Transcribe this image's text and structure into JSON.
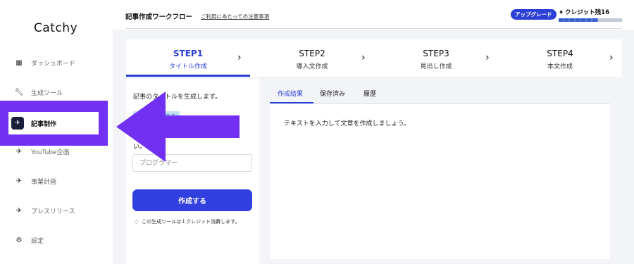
{
  "sidebar": {
    "logo": "Catchy",
    "items": [
      {
        "label": "ダッシュボード",
        "icon": "dashboard-icon"
      },
      {
        "label": "生成ツール",
        "icon": "wrench-icon"
      },
      {
        "label": "記事制作",
        "icon": "bird-icon",
        "active": true
      },
      {
        "label": "YouTube企画",
        "icon": "bird-icon"
      },
      {
        "label": "事業計画",
        "icon": "bird-icon"
      },
      {
        "label": "プレスリリース",
        "icon": "bird-icon"
      },
      {
        "label": "設定",
        "icon": "gear-icon"
      }
    ]
  },
  "header": {
    "title": "記事作成ワークフロー",
    "notice_link": "ご利用にあたっての注意事項",
    "upgrade_label": "アップグレード",
    "credit_label": "クレジット残16",
    "credit_remaining": 16
  },
  "steps": [
    {
      "num": "STEP1",
      "label": "タイトル作成",
      "active": true
    },
    {
      "num": "STEP2",
      "label": "導入文作成"
    },
    {
      "num": "STEP3",
      "label": "見出し作成"
    },
    {
      "num": "STEP4",
      "label": "本文作成"
    }
  ],
  "form": {
    "instruction": "記事のタイトルを生成します。",
    "example_tag": "例文を入力する",
    "clipped_text": "い。",
    "input_placeholder": "プログラマー",
    "create_label": "作成する",
    "cost_note": "この生成ツールは１クレジット消費します。"
  },
  "result_tabs": [
    "作成結果",
    "保存済み",
    "履歴"
  ],
  "output_text": "テキストを入力して文章を作成しましょう。",
  "colors": {
    "accent": "#2b3fd8",
    "button": "#3340e0",
    "annotation": "#7230f3"
  }
}
